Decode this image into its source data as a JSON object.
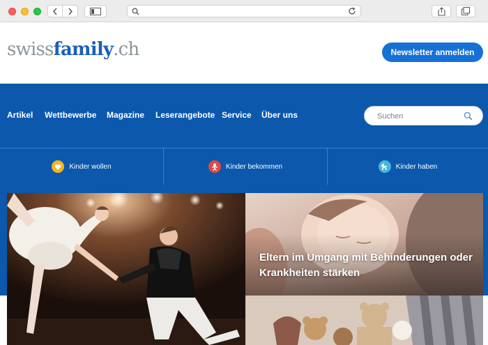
{
  "browser": {
    "search_icon": "search-icon",
    "reload_icon": "reload-icon",
    "share_icon": "share-icon",
    "tabs_icon": "tabs-icon"
  },
  "header": {
    "logo_part1": "swiss",
    "logo_part2": "family",
    "logo_part3": ".ch",
    "newsletter_label": "Newsletter anmelden",
    "brand_color": "#1671d6"
  },
  "nav": {
    "items": [
      {
        "label": "Artikel"
      },
      {
        "label": "Wettbewerbe"
      },
      {
        "label": "Magazine"
      },
      {
        "label": "Leserangebote"
      },
      {
        "label": "Service"
      },
      {
        "label": "Über uns"
      }
    ],
    "search_placeholder": "Suchen",
    "band_color": "#0b58ad"
  },
  "life_stages": [
    {
      "label": "Kinder wollen",
      "icon": "heart-icon",
      "color": "#f2b61d"
    },
    {
      "label": "Kinder bekommen",
      "icon": "baby-icon",
      "color": "#e04845"
    },
    {
      "label": "Kinder haben",
      "icon": "stroller-icon",
      "color": "#45b7d8"
    }
  ],
  "hero": {
    "main_article_image": "ballet-dancers-photo",
    "feature_headline": "Eltern im Umgang mit Behinderungen oder Krankheiten stärken",
    "feature_image": "sleeping-baby-photo",
    "teaser_image": "teddy-bears-photo"
  }
}
